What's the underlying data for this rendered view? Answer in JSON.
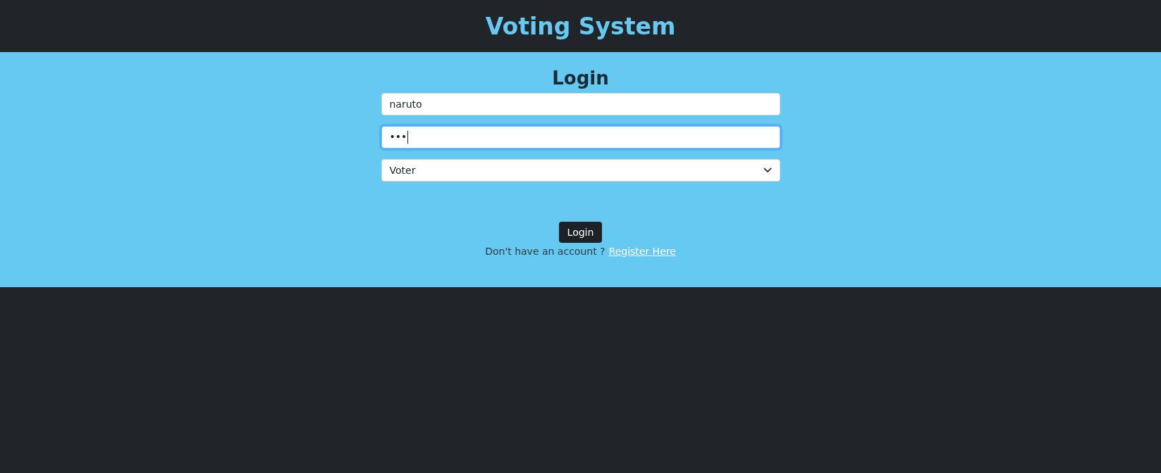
{
  "header": {
    "title": "Voting System"
  },
  "form": {
    "heading": "Login",
    "fields": [
      {
        "kind": "text",
        "value": "naruto",
        "focused": false
      },
      {
        "kind": "password",
        "value": "•••",
        "focused": true
      },
      {
        "kind": "select",
        "value": "Voter",
        "focused": false
      }
    ],
    "button": "Login",
    "prompt": "Don't have an account ?",
    "link": "Register Here"
  }
}
